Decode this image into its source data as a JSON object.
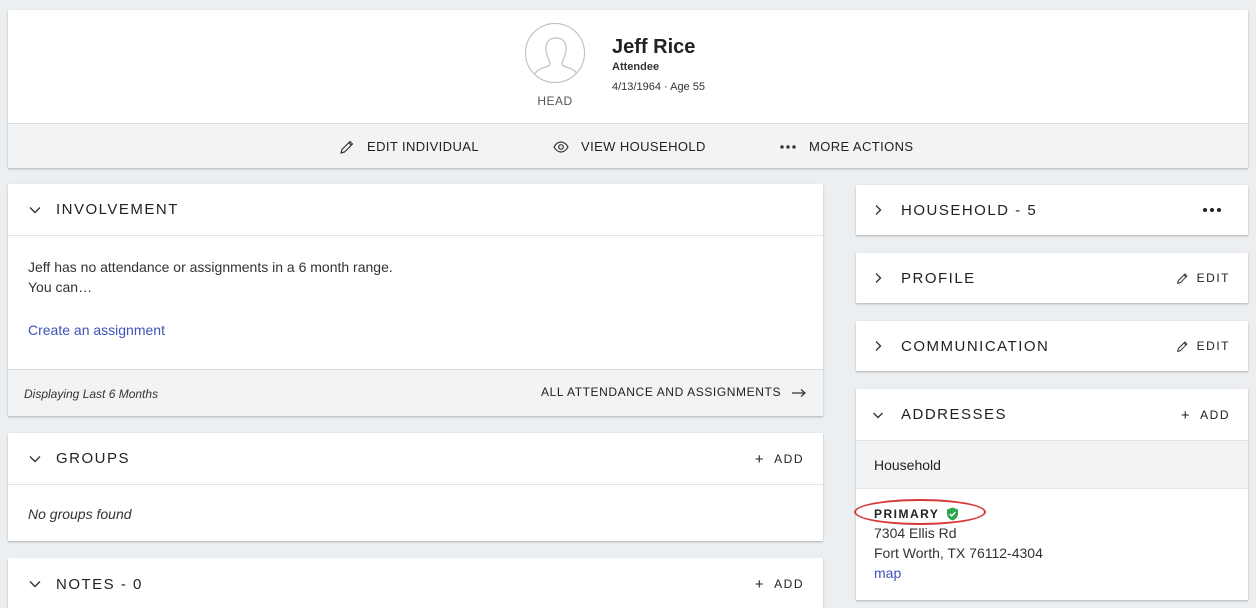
{
  "person": {
    "name": "Jeff Rice",
    "status": "Attendee",
    "dob": "4/13/1964 · Age 55",
    "role": "HEAD"
  },
  "header_actions": {
    "edit_individual": "EDIT INDIVIDUAL",
    "view_household": "VIEW HOUSEHOLD",
    "more_actions": "MORE ACTIONS"
  },
  "involvement": {
    "title": "INVOLVEMENT",
    "message_line1": "Jeff has no attendance or assignments in a 6 month range.",
    "message_line2": "You can…",
    "create_link": "Create an assignment",
    "footer_note": "Displaying Last 6 Months",
    "all_link": "ALL ATTENDANCE AND ASSIGNMENTS"
  },
  "groups": {
    "title": "GROUPS",
    "add_label": "ADD",
    "empty": "No groups found"
  },
  "notes": {
    "title": "NOTES - 0",
    "add_label": "ADD"
  },
  "household": {
    "title": "HOUSEHOLD - 5",
    "more": "•••"
  },
  "profile": {
    "title": "PROFILE",
    "edit_label": "EDIT"
  },
  "communication": {
    "title": "COMMUNICATION",
    "edit_label": "EDIT"
  },
  "addresses": {
    "title": "ADDRESSES",
    "add_label": "ADD",
    "group_label": "Household",
    "primary_label": "PRIMARY",
    "street": "7304 Ellis Rd",
    "city_state_zip": "Fort Worth, TX 76112-4304",
    "map_link": "map"
  },
  "colors": {
    "link": "#3f51b5",
    "verified": "#2ea84a",
    "annotation": "#d63a3a"
  }
}
